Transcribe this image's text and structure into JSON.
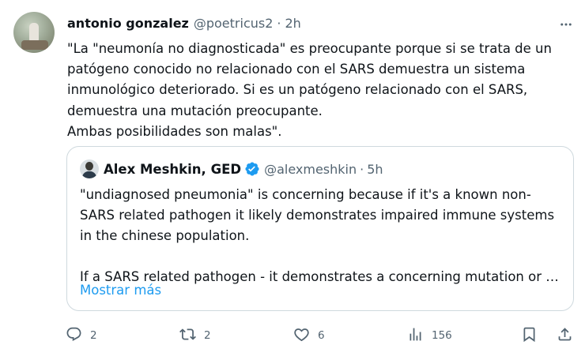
{
  "tweet": {
    "author_name": "antonio gonzalez",
    "handle": "@poetricus2",
    "separator": "·",
    "time": "2h",
    "text_lines": [
      "\"La \"neumonía no diagnosticada\" es preocupante porque si se trata de un",
      "patógeno conocido no relacionado con el SARS demuestra un sistema",
      "inmunológico deteriorado. Si es un patógeno relacionado con el SARS,",
      "demuestra una mutación preocupante.",
      "Ambas posibilidades son malas\"."
    ]
  },
  "quote": {
    "author_name": "Alex Meshkin, GED",
    "handle": "@alexmeshkin",
    "separator": "·",
    "time": "5h",
    "verified": true,
    "text_lines": [
      "\"undiagnosed pneumonia\" is concerning because if it's a known non-",
      "SARS related pathogen it likely demonstrates impaired immune systems",
      "in the chinese population.",
      "If a SARS related pathogen - it demonstrates a concerning mutation or …"
    ],
    "show_more_label": "Mostrar más"
  },
  "actions": {
    "replies": "2",
    "reposts": "2",
    "likes": "6",
    "views": "156"
  },
  "icons": {
    "more": "more-icon",
    "reply": "reply-icon",
    "repost": "repost-icon",
    "like": "like-icon",
    "views": "views-icon",
    "bookmark": "bookmark-icon",
    "share": "share-icon",
    "verified": "verified-badge-icon"
  },
  "colors": {
    "text": "#0f1419",
    "muted": "#536471",
    "link": "#1d9bf0",
    "border": "#cfd9de"
  }
}
